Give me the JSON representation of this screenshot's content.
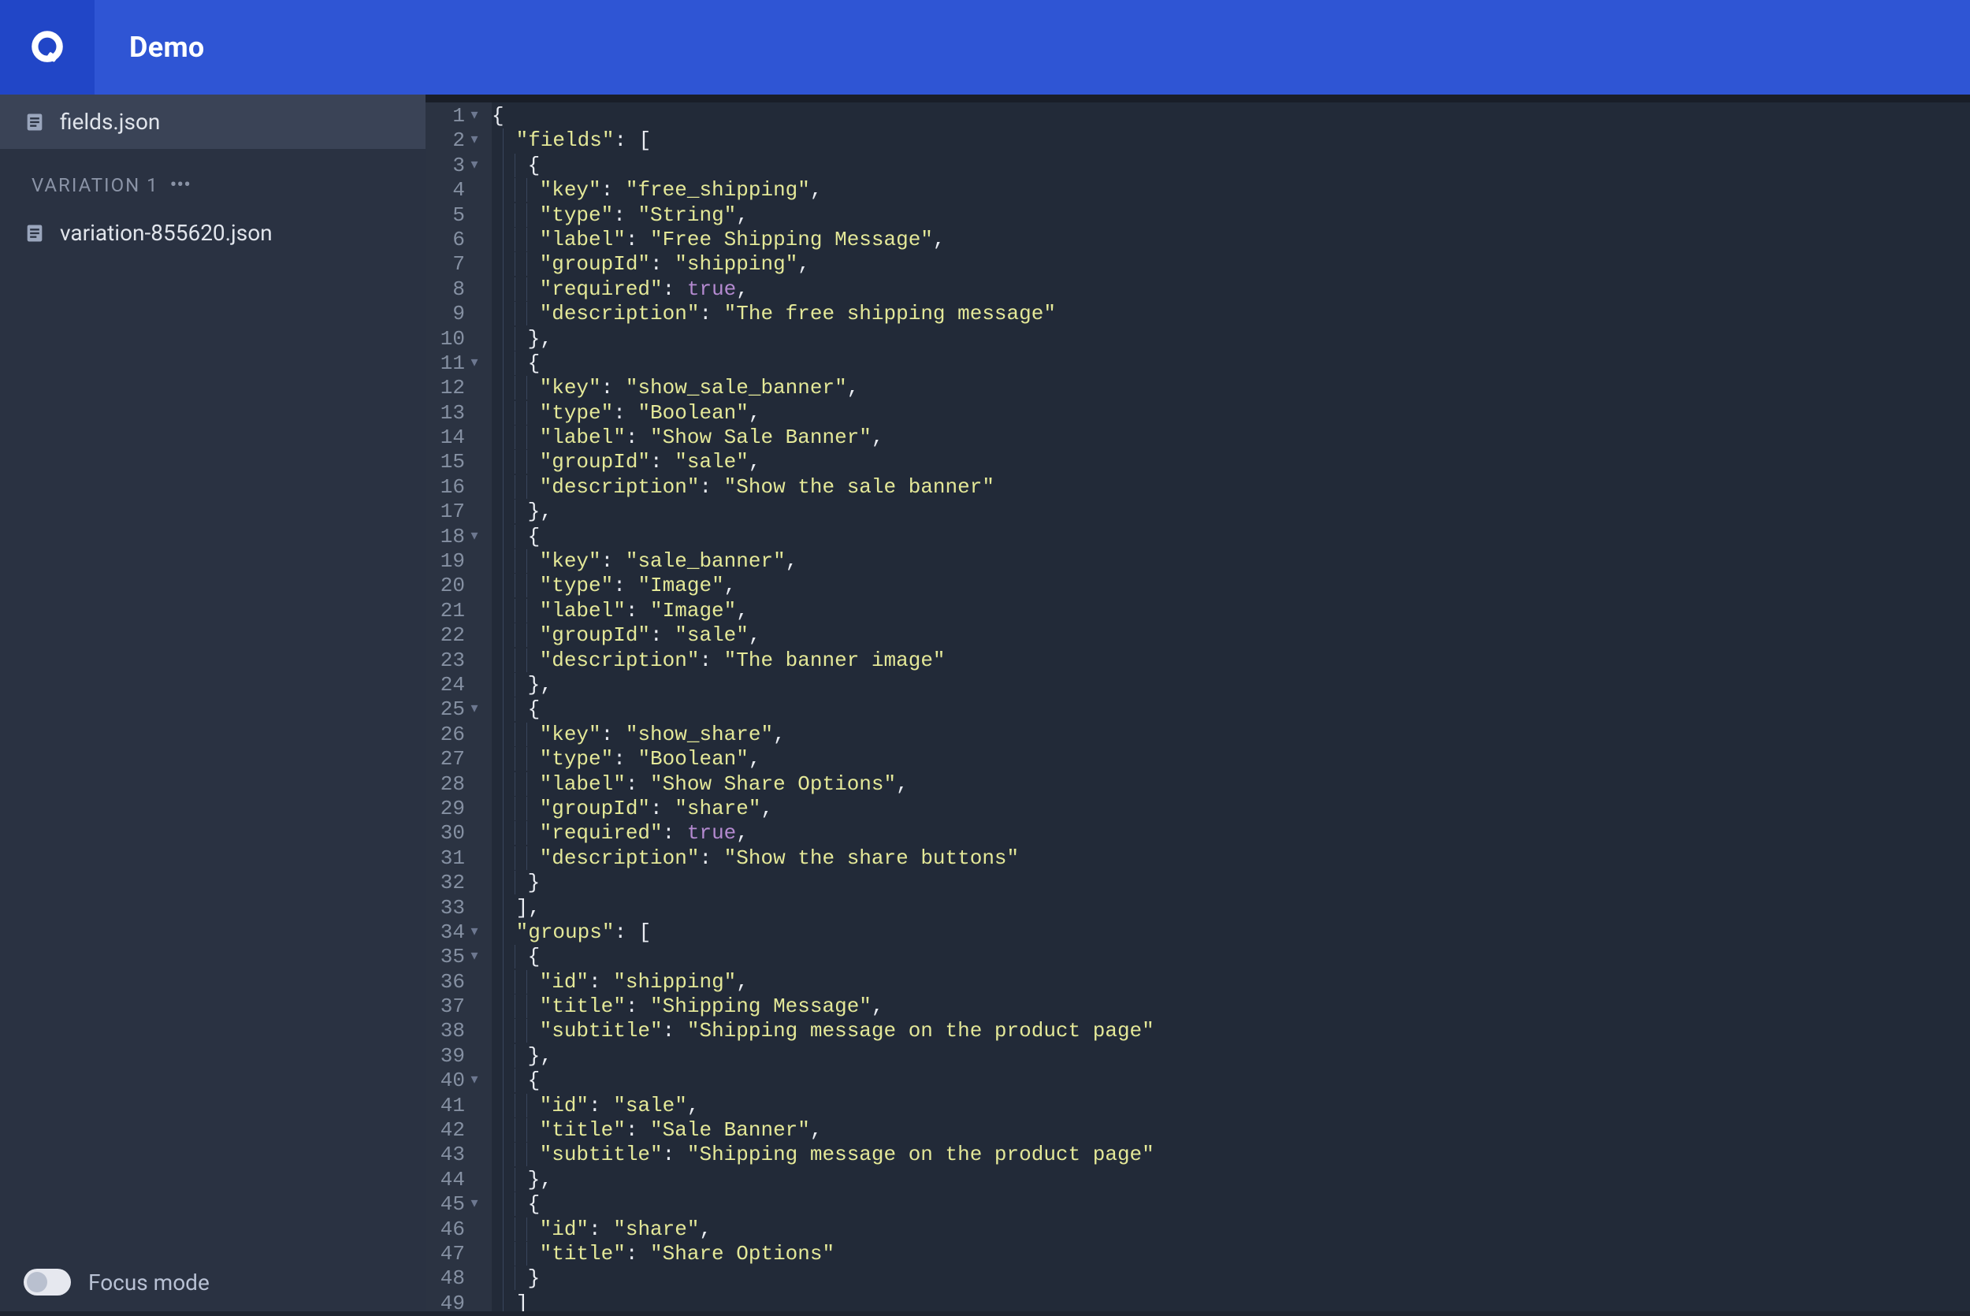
{
  "header": {
    "title": "Demo"
  },
  "sidebar": {
    "files": [
      {
        "name": "fields.json",
        "active": true
      }
    ],
    "section_label": "VARIATION 1",
    "variation_files": [
      {
        "name": "variation-855620.json",
        "active": false
      }
    ],
    "focus_mode_label": "Focus mode",
    "focus_mode_on": false
  },
  "editor": {
    "file": "fields.json",
    "lines": [
      {
        "n": 1,
        "fold": true,
        "indent": 0,
        "tokens": [
          [
            "p",
            "{"
          ]
        ]
      },
      {
        "n": 2,
        "fold": true,
        "indent": 1,
        "tokens": [
          [
            "k",
            "\"fields\""
          ],
          [
            "p",
            ": ["
          ]
        ]
      },
      {
        "n": 3,
        "fold": true,
        "indent": 2,
        "tokens": [
          [
            "p",
            "{"
          ]
        ]
      },
      {
        "n": 4,
        "fold": false,
        "indent": 3,
        "tokens": [
          [
            "k",
            "\"key\""
          ],
          [
            "p",
            ": "
          ],
          [
            "s",
            "\"free_shipping\""
          ],
          [
            "p",
            ","
          ]
        ]
      },
      {
        "n": 5,
        "fold": false,
        "indent": 3,
        "tokens": [
          [
            "k",
            "\"type\""
          ],
          [
            "p",
            ": "
          ],
          [
            "s",
            "\"String\""
          ],
          [
            "p",
            ","
          ]
        ]
      },
      {
        "n": 6,
        "fold": false,
        "indent": 3,
        "tokens": [
          [
            "k",
            "\"label\""
          ],
          [
            "p",
            ": "
          ],
          [
            "s",
            "\"Free Shipping Message\""
          ],
          [
            "p",
            ","
          ]
        ]
      },
      {
        "n": 7,
        "fold": false,
        "indent": 3,
        "tokens": [
          [
            "k",
            "\"groupId\""
          ],
          [
            "p",
            ": "
          ],
          [
            "s",
            "\"shipping\""
          ],
          [
            "p",
            ","
          ]
        ]
      },
      {
        "n": 8,
        "fold": false,
        "indent": 3,
        "tokens": [
          [
            "k",
            "\"required\""
          ],
          [
            "p",
            ": "
          ],
          [
            "b",
            "true"
          ],
          [
            "p",
            ","
          ]
        ]
      },
      {
        "n": 9,
        "fold": false,
        "indent": 3,
        "tokens": [
          [
            "k",
            "\"description\""
          ],
          [
            "p",
            ": "
          ],
          [
            "s",
            "\"The free shipping message\""
          ]
        ]
      },
      {
        "n": 10,
        "fold": false,
        "indent": 2,
        "tokens": [
          [
            "p",
            "},"
          ]
        ]
      },
      {
        "n": 11,
        "fold": true,
        "indent": 2,
        "tokens": [
          [
            "p",
            "{"
          ]
        ]
      },
      {
        "n": 12,
        "fold": false,
        "indent": 3,
        "tokens": [
          [
            "k",
            "\"key\""
          ],
          [
            "p",
            ": "
          ],
          [
            "s",
            "\"show_sale_banner\""
          ],
          [
            "p",
            ","
          ]
        ]
      },
      {
        "n": 13,
        "fold": false,
        "indent": 3,
        "tokens": [
          [
            "k",
            "\"type\""
          ],
          [
            "p",
            ": "
          ],
          [
            "s",
            "\"Boolean\""
          ],
          [
            "p",
            ","
          ]
        ]
      },
      {
        "n": 14,
        "fold": false,
        "indent": 3,
        "tokens": [
          [
            "k",
            "\"label\""
          ],
          [
            "p",
            ": "
          ],
          [
            "s",
            "\"Show Sale Banner\""
          ],
          [
            "p",
            ","
          ]
        ]
      },
      {
        "n": 15,
        "fold": false,
        "indent": 3,
        "tokens": [
          [
            "k",
            "\"groupId\""
          ],
          [
            "p",
            ": "
          ],
          [
            "s",
            "\"sale\""
          ],
          [
            "p",
            ","
          ]
        ]
      },
      {
        "n": 16,
        "fold": false,
        "indent": 3,
        "tokens": [
          [
            "k",
            "\"description\""
          ],
          [
            "p",
            ": "
          ],
          [
            "s",
            "\"Show the sale banner\""
          ]
        ]
      },
      {
        "n": 17,
        "fold": false,
        "indent": 2,
        "tokens": [
          [
            "p",
            "},"
          ]
        ]
      },
      {
        "n": 18,
        "fold": true,
        "indent": 2,
        "tokens": [
          [
            "p",
            "{"
          ]
        ]
      },
      {
        "n": 19,
        "fold": false,
        "indent": 3,
        "tokens": [
          [
            "k",
            "\"key\""
          ],
          [
            "p",
            ": "
          ],
          [
            "s",
            "\"sale_banner\""
          ],
          [
            "p",
            ","
          ]
        ]
      },
      {
        "n": 20,
        "fold": false,
        "indent": 3,
        "tokens": [
          [
            "k",
            "\"type\""
          ],
          [
            "p",
            ": "
          ],
          [
            "s",
            "\"Image\""
          ],
          [
            "p",
            ","
          ]
        ]
      },
      {
        "n": 21,
        "fold": false,
        "indent": 3,
        "tokens": [
          [
            "k",
            "\"label\""
          ],
          [
            "p",
            ": "
          ],
          [
            "s",
            "\"Image\""
          ],
          [
            "p",
            ","
          ]
        ]
      },
      {
        "n": 22,
        "fold": false,
        "indent": 3,
        "tokens": [
          [
            "k",
            "\"groupId\""
          ],
          [
            "p",
            ": "
          ],
          [
            "s",
            "\"sale\""
          ],
          [
            "p",
            ","
          ]
        ]
      },
      {
        "n": 23,
        "fold": false,
        "indent": 3,
        "tokens": [
          [
            "k",
            "\"description\""
          ],
          [
            "p",
            ": "
          ],
          [
            "s",
            "\"The banner image\""
          ]
        ]
      },
      {
        "n": 24,
        "fold": false,
        "indent": 2,
        "tokens": [
          [
            "p",
            "},"
          ]
        ]
      },
      {
        "n": 25,
        "fold": true,
        "indent": 2,
        "tokens": [
          [
            "p",
            "{"
          ]
        ]
      },
      {
        "n": 26,
        "fold": false,
        "indent": 3,
        "tokens": [
          [
            "k",
            "\"key\""
          ],
          [
            "p",
            ": "
          ],
          [
            "s",
            "\"show_share\""
          ],
          [
            "p",
            ","
          ]
        ]
      },
      {
        "n": 27,
        "fold": false,
        "indent": 3,
        "tokens": [
          [
            "k",
            "\"type\""
          ],
          [
            "p",
            ": "
          ],
          [
            "s",
            "\"Boolean\""
          ],
          [
            "p",
            ","
          ]
        ]
      },
      {
        "n": 28,
        "fold": false,
        "indent": 3,
        "tokens": [
          [
            "k",
            "\"label\""
          ],
          [
            "p",
            ": "
          ],
          [
            "s",
            "\"Show Share Options\""
          ],
          [
            "p",
            ","
          ]
        ]
      },
      {
        "n": 29,
        "fold": false,
        "indent": 3,
        "tokens": [
          [
            "k",
            "\"groupId\""
          ],
          [
            "p",
            ": "
          ],
          [
            "s",
            "\"share\""
          ],
          [
            "p",
            ","
          ]
        ]
      },
      {
        "n": 30,
        "fold": false,
        "indent": 3,
        "tokens": [
          [
            "k",
            "\"required\""
          ],
          [
            "p",
            ": "
          ],
          [
            "b",
            "true"
          ],
          [
            "p",
            ","
          ]
        ]
      },
      {
        "n": 31,
        "fold": false,
        "indent": 3,
        "tokens": [
          [
            "k",
            "\"description\""
          ],
          [
            "p",
            ": "
          ],
          [
            "s",
            "\"Show the share buttons\""
          ]
        ]
      },
      {
        "n": 32,
        "fold": false,
        "indent": 2,
        "tokens": [
          [
            "p",
            "}"
          ]
        ]
      },
      {
        "n": 33,
        "fold": false,
        "indent": 1,
        "tokens": [
          [
            "p",
            "],"
          ]
        ]
      },
      {
        "n": 34,
        "fold": true,
        "indent": 1,
        "tokens": [
          [
            "k",
            "\"groups\""
          ],
          [
            "p",
            ": ["
          ]
        ]
      },
      {
        "n": 35,
        "fold": true,
        "indent": 2,
        "tokens": [
          [
            "p",
            "{"
          ]
        ]
      },
      {
        "n": 36,
        "fold": false,
        "indent": 3,
        "tokens": [
          [
            "k",
            "\"id\""
          ],
          [
            "p",
            ": "
          ],
          [
            "s",
            "\"shipping\""
          ],
          [
            "p",
            ","
          ]
        ]
      },
      {
        "n": 37,
        "fold": false,
        "indent": 3,
        "tokens": [
          [
            "k",
            "\"title\""
          ],
          [
            "p",
            ": "
          ],
          [
            "s",
            "\"Shipping Message\""
          ],
          [
            "p",
            ","
          ]
        ]
      },
      {
        "n": 38,
        "fold": false,
        "indent": 3,
        "tokens": [
          [
            "k",
            "\"subtitle\""
          ],
          [
            "p",
            ": "
          ],
          [
            "s",
            "\"Shipping message on the product page\""
          ]
        ]
      },
      {
        "n": 39,
        "fold": false,
        "indent": 2,
        "tokens": [
          [
            "p",
            "},"
          ]
        ]
      },
      {
        "n": 40,
        "fold": true,
        "indent": 2,
        "tokens": [
          [
            "p",
            "{"
          ]
        ]
      },
      {
        "n": 41,
        "fold": false,
        "indent": 3,
        "tokens": [
          [
            "k",
            "\"id\""
          ],
          [
            "p",
            ": "
          ],
          [
            "s",
            "\"sale\""
          ],
          [
            "p",
            ","
          ]
        ]
      },
      {
        "n": 42,
        "fold": false,
        "indent": 3,
        "tokens": [
          [
            "k",
            "\"title\""
          ],
          [
            "p",
            ": "
          ],
          [
            "s",
            "\"Sale Banner\""
          ],
          [
            "p",
            ","
          ]
        ]
      },
      {
        "n": 43,
        "fold": false,
        "indent": 3,
        "tokens": [
          [
            "k",
            "\"subtitle\""
          ],
          [
            "p",
            ": "
          ],
          [
            "s",
            "\"Shipping message on the product page\""
          ]
        ]
      },
      {
        "n": 44,
        "fold": false,
        "indent": 2,
        "tokens": [
          [
            "p",
            "},"
          ]
        ]
      },
      {
        "n": 45,
        "fold": true,
        "indent": 2,
        "tokens": [
          [
            "p",
            "{"
          ]
        ]
      },
      {
        "n": 46,
        "fold": false,
        "indent": 3,
        "tokens": [
          [
            "k",
            "\"id\""
          ],
          [
            "p",
            ": "
          ],
          [
            "s",
            "\"share\""
          ],
          [
            "p",
            ","
          ]
        ]
      },
      {
        "n": 47,
        "fold": false,
        "indent": 3,
        "tokens": [
          [
            "k",
            "\"title\""
          ],
          [
            "p",
            ": "
          ],
          [
            "s",
            "\"Share Options\""
          ]
        ]
      },
      {
        "n": 48,
        "fold": false,
        "indent": 2,
        "tokens": [
          [
            "p",
            "}"
          ]
        ]
      },
      {
        "n": 49,
        "fold": false,
        "indent": 1,
        "tokens": [
          [
            "p",
            "]"
          ]
        ]
      }
    ]
  }
}
